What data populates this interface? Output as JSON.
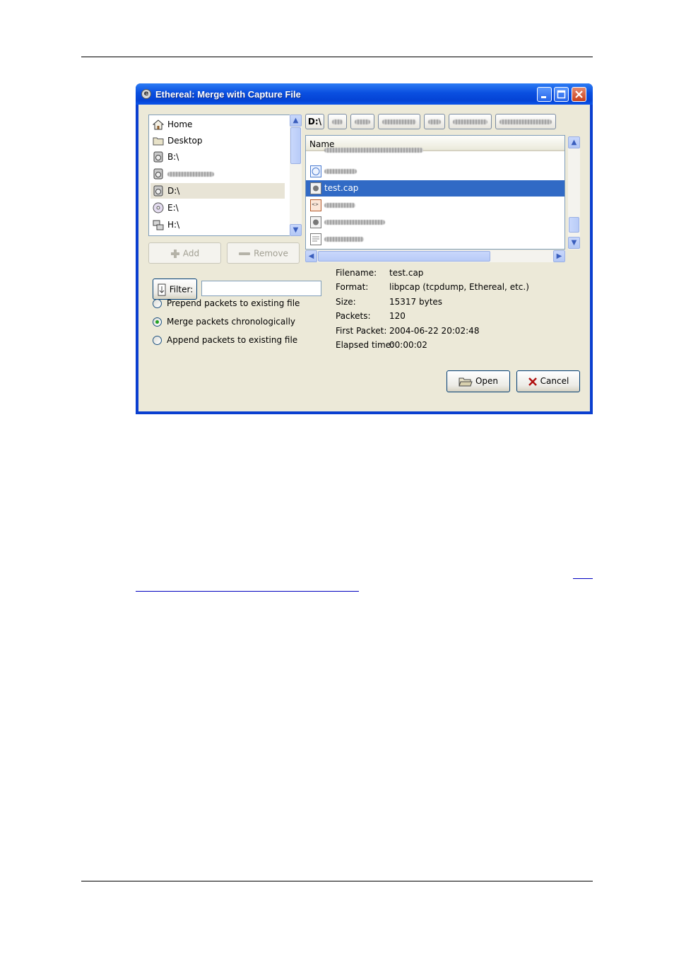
{
  "window": {
    "title": "Ethereal: Merge with Capture File",
    "controls": [
      "minimize-icon",
      "maximize-icon",
      "close-icon"
    ]
  },
  "places": {
    "items": [
      {
        "label": "Home",
        "icon": "home-icon"
      },
      {
        "label": "Desktop",
        "icon": "folder-icon"
      },
      {
        "label": "B:\\",
        "icon": "drive-icon"
      },
      {
        "label": "",
        "icon": "drive-icon"
      },
      {
        "label": "D:\\",
        "icon": "drive-icon",
        "selected": true
      },
      {
        "label": "E:\\",
        "icon": "cd-icon"
      },
      {
        "label": "H:\\",
        "icon": "network-drive-icon"
      }
    ],
    "add_label": "Add",
    "remove_label": "Remove"
  },
  "path_bar": {
    "current": "D:\\"
  },
  "file_list": {
    "column_header": "Name",
    "rows": [
      {
        "label": "",
        "icon": "capture-file-icon"
      },
      {
        "label": "",
        "icon": "info-file-icon"
      },
      {
        "label": "test.cap",
        "icon": "capture-file-icon",
        "selected": true
      },
      {
        "label": "",
        "icon": "html-file-icon"
      },
      {
        "label": "",
        "icon": "capture-file-icon"
      },
      {
        "label": "",
        "icon": "text-file-icon"
      }
    ]
  },
  "filter": {
    "label": "Filter:",
    "value": ""
  },
  "merge_options": [
    {
      "label": "Prepend packets to existing file",
      "checked": false
    },
    {
      "label": "Merge packets chronologically",
      "checked": true
    },
    {
      "label": "Append packets to existing file",
      "checked": false
    }
  ],
  "file_info": [
    {
      "key": "Filename:",
      "value": "test.cap"
    },
    {
      "key": "Format:",
      "value": "libpcap (tcpdump, Ethereal, etc.)"
    },
    {
      "key": "Size:",
      "value": "15317 bytes"
    },
    {
      "key": "Packets:",
      "value": "120"
    },
    {
      "key": "First Packet:",
      "value": "2004-06-22 20:02:48"
    },
    {
      "key": "Elapsed time:",
      "value": "00:00:02"
    }
  ],
  "buttons": {
    "open_label": "Open",
    "cancel_label": "Cancel"
  },
  "colors": {
    "selection": "#316ac5",
    "titlebar": "#0a4fe0",
    "dialog_bg": "#ece9d8"
  }
}
